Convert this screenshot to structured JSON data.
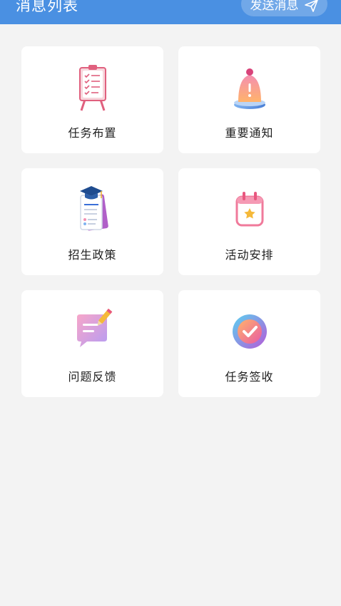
{
  "header": {
    "title": "消息列表",
    "send_label": "发送消息",
    "send_icon": "paper-plane-icon",
    "color": "#4a90e2"
  },
  "cards": [
    {
      "label": "任务布置",
      "icon": "clipboard-checklist-icon"
    },
    {
      "label": "重要通知",
      "icon": "bell-icon"
    },
    {
      "label": "招生政策",
      "icon": "graduation-book-icon"
    },
    {
      "label": "活动安排",
      "icon": "calendar-icon"
    },
    {
      "label": "问题反馈",
      "icon": "feedback-message-icon"
    },
    {
      "label": "任务签收",
      "icon": "check-badge-icon"
    }
  ]
}
